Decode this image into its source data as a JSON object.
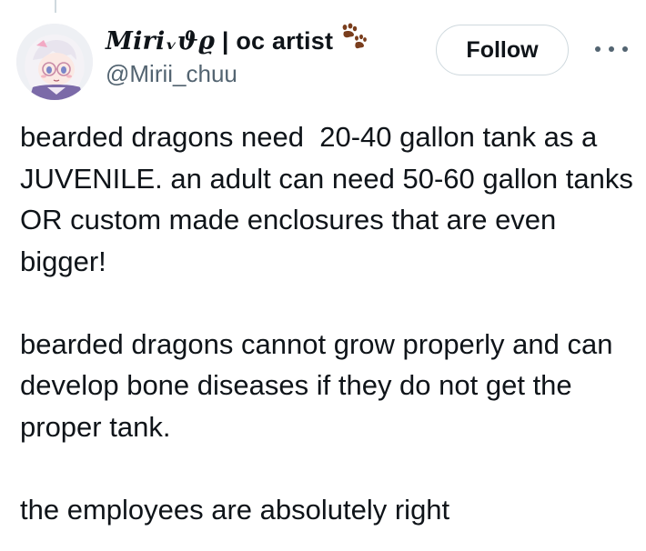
{
  "author": {
    "display_name_script": "Miriᵥϑϱ",
    "display_name_rest": " | oc artist",
    "handle": "@Mirii_chuu",
    "badge_icon": "paw-prints-icon"
  },
  "actions": {
    "follow_label": "Follow",
    "more_icon": "more-horizontal-icon"
  },
  "tweet": {
    "paragraphs": [
      "bearded dragons need  20-40 gallon tank as a JUVENILE. an adult can need 50-60 gallon tanks OR custom made enclosures that are even bigger!",
      "bearded dragons cannot grow properly and can develop bone diseases if they do not get the proper tank.",
      "the employees are absolutely right"
    ]
  },
  "colors": {
    "text": "#0f1419",
    "secondary_text": "#536471",
    "border": "#cfd9de",
    "paw": "#7a3e1d"
  }
}
